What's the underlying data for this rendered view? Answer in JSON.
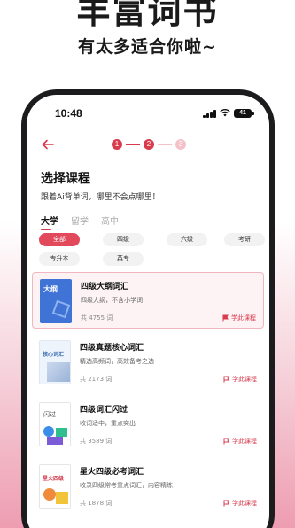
{
  "hero": {
    "title": "丰富词书",
    "subtitle": "有太多适合你啦~"
  },
  "status_bar": {
    "time": "10:48",
    "battery": "41"
  },
  "stepper": {
    "steps": [
      "1",
      "2",
      "3"
    ]
  },
  "page": {
    "title": "选择课程",
    "subtitle": "跟着Ai背单词，哪里不会点哪里！"
  },
  "tabs": [
    "大学",
    "留学",
    "高中"
  ],
  "filters": [
    "全部",
    "四级",
    "六级",
    "考研",
    "专升本",
    "英专"
  ],
  "courses": [
    {
      "name": "四级大纲词汇",
      "desc": "四级大纲，不含小学词",
      "count": "共 4755 词",
      "action": "学此课程",
      "cover_text": "大纲"
    },
    {
      "name": "四级真题核心词汇",
      "desc": "精选高频词，高效备考之选",
      "count": "共 2173 词",
      "action": "学此课程",
      "cover_text": "核心词汇"
    },
    {
      "name": "四级词汇闪过",
      "desc": "收词适中，重点突出",
      "count": "共 3589 词",
      "action": "学此课程",
      "cover_text": "闪过"
    },
    {
      "name": "星火四级必考词汇",
      "desc": "收录四级常考重点词汇，内容精练",
      "count": "共 1878 词",
      "action": "学此课程",
      "cover_text": "星火四级"
    }
  ],
  "colors": {
    "accent": "#d93a4c",
    "accent_light": "#f4c2c8",
    "chip_active": "#e24a5c"
  }
}
